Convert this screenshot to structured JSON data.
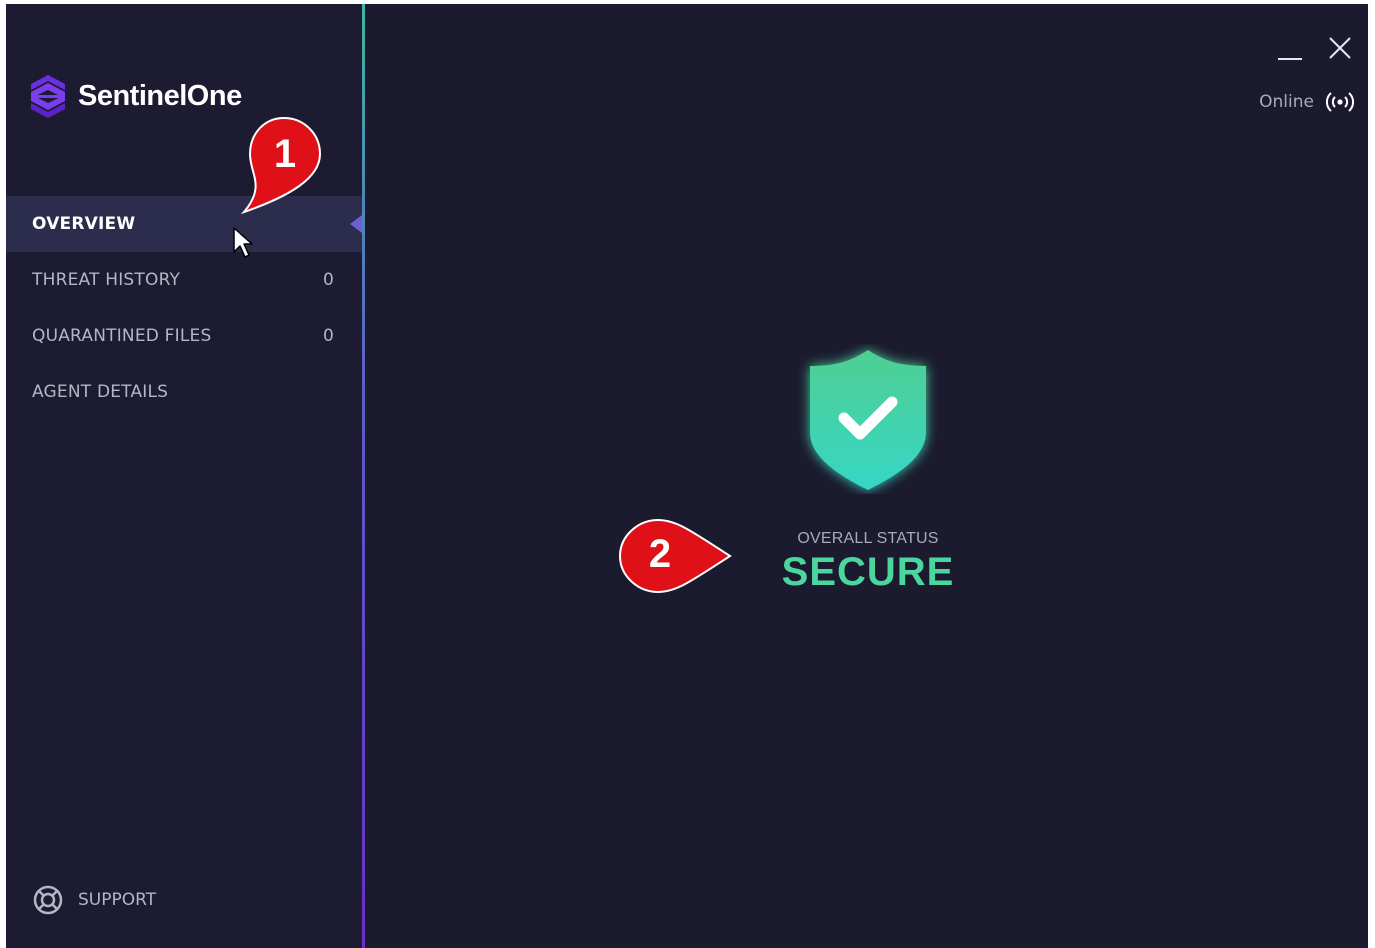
{
  "app": {
    "brand_name": "SentinelOne",
    "accent_color": "#6e5fd8",
    "secure_color": "#4bd69e"
  },
  "sidebar": {
    "items": [
      {
        "label": "OVERVIEW",
        "count": "",
        "active": true
      },
      {
        "label": "THREAT HISTORY",
        "count": "0",
        "active": false
      },
      {
        "label": "QUARANTINED FILES",
        "count": "0",
        "active": false
      },
      {
        "label": "AGENT DETAILS",
        "count": "",
        "active": false
      }
    ],
    "support_label": "SUPPORT"
  },
  "header": {
    "connection_status": "Online",
    "connection_icon": "broadcast-icon"
  },
  "main": {
    "status_caption": "OVERALL STATUS",
    "status_value": "SECURE",
    "status_icon": "shield-check-icon"
  },
  "annotations": {
    "callout_1": "1",
    "callout_2": "2"
  }
}
